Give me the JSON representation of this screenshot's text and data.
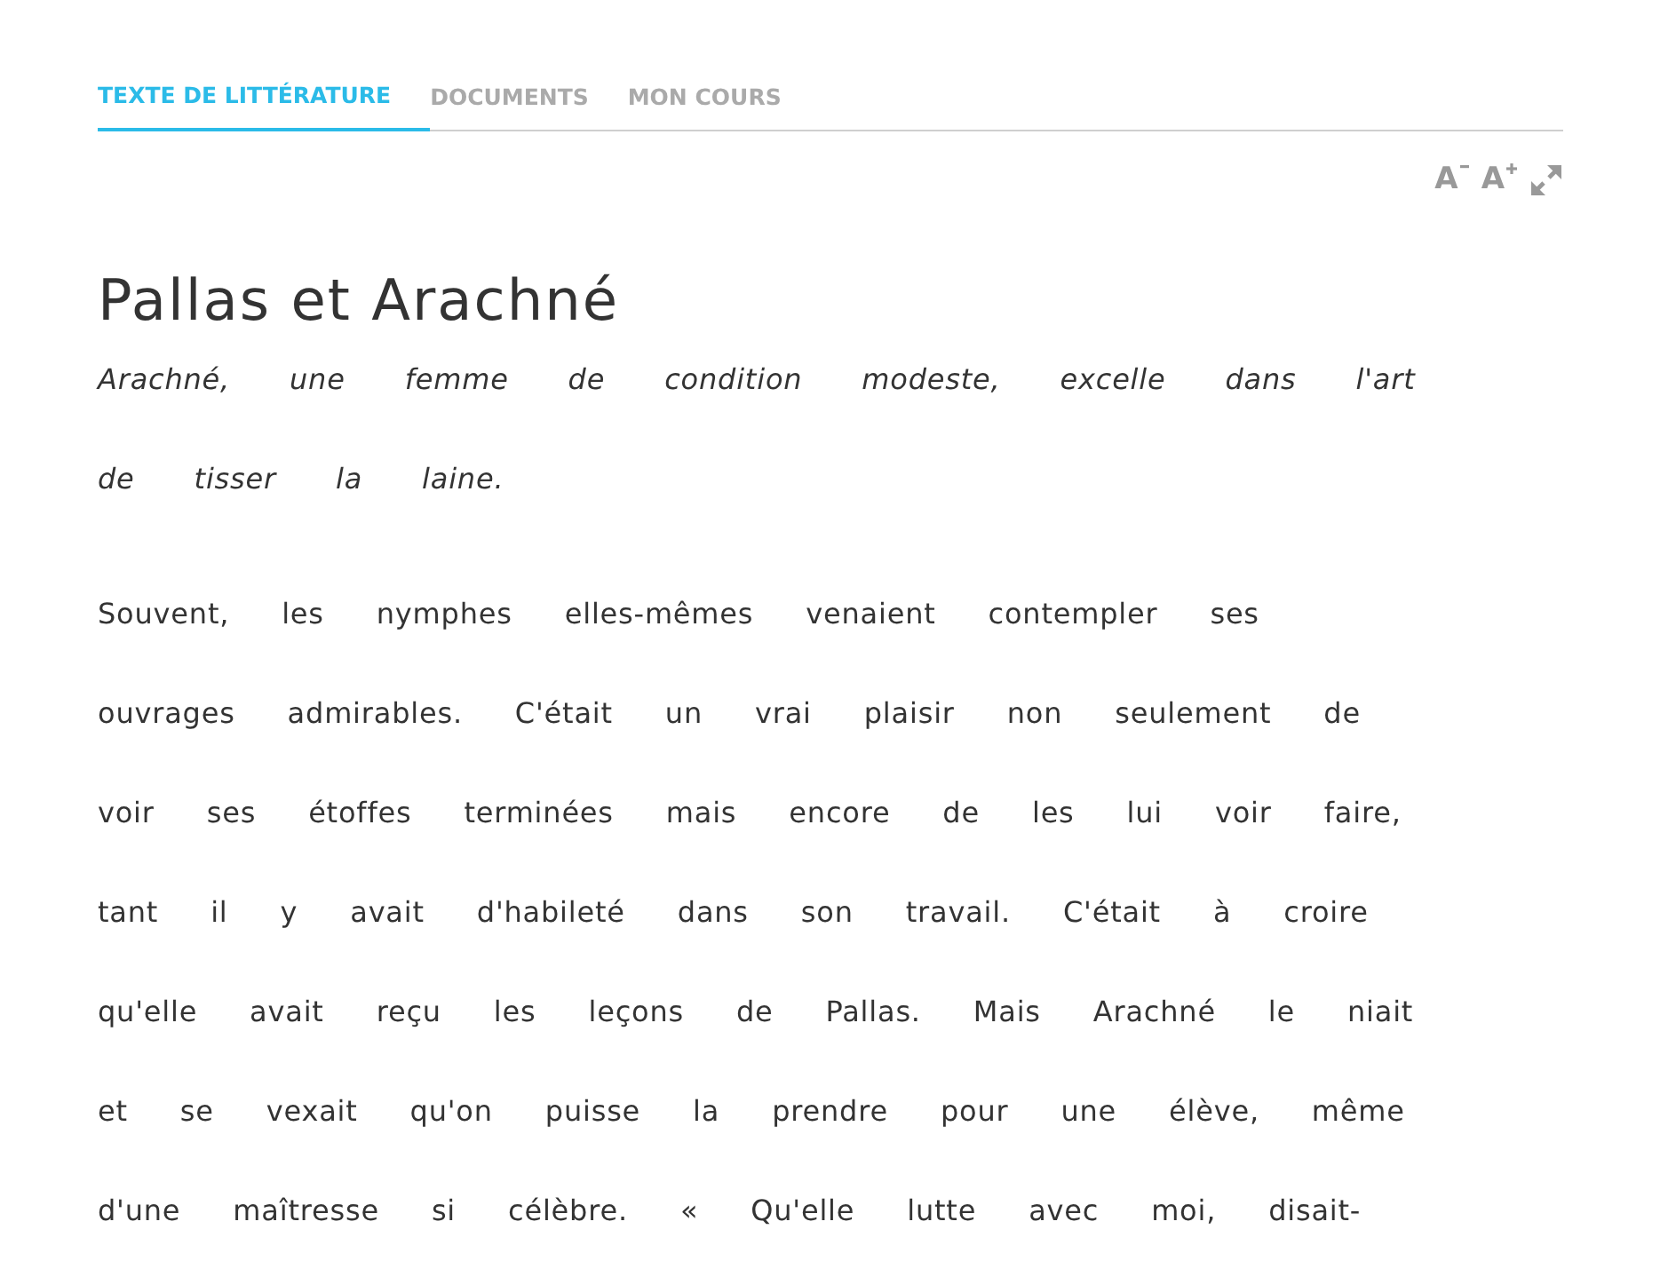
{
  "tabs": [
    {
      "label": "TEXTE DE LITTÉRATURE",
      "selected": true
    },
    {
      "label": "DOCUMENTS",
      "selected": false
    },
    {
      "label": "MON COURS",
      "selected": false
    }
  ],
  "text_tools": {
    "decrease": "A",
    "increase": "A"
  },
  "title": "Pallas et Arachné",
  "intro": {
    "lines": [
      "Arachné, une femme de condition modeste, excelle dans l'art",
      "de tisser la laine."
    ]
  },
  "paragraph": {
    "lines": [
      "Souvent, les nymphes elles-mêmes venaient contempler ses",
      "ouvrages admirables. C'était un vrai plaisir non seulement de",
      "voir ses étoffes terminées mais encore de les lui voir faire,",
      "tant il y avait d'habileté dans son travail. C'était à croire",
      "qu'elle avait reçu les leçons de Pallas. Mais Arachné le niait",
      "et se vexait qu'on puisse la prendre pour une élève, même",
      "d'une maîtresse si célèbre. « Qu'elle lutte avec moi, disait-"
    ]
  }
}
